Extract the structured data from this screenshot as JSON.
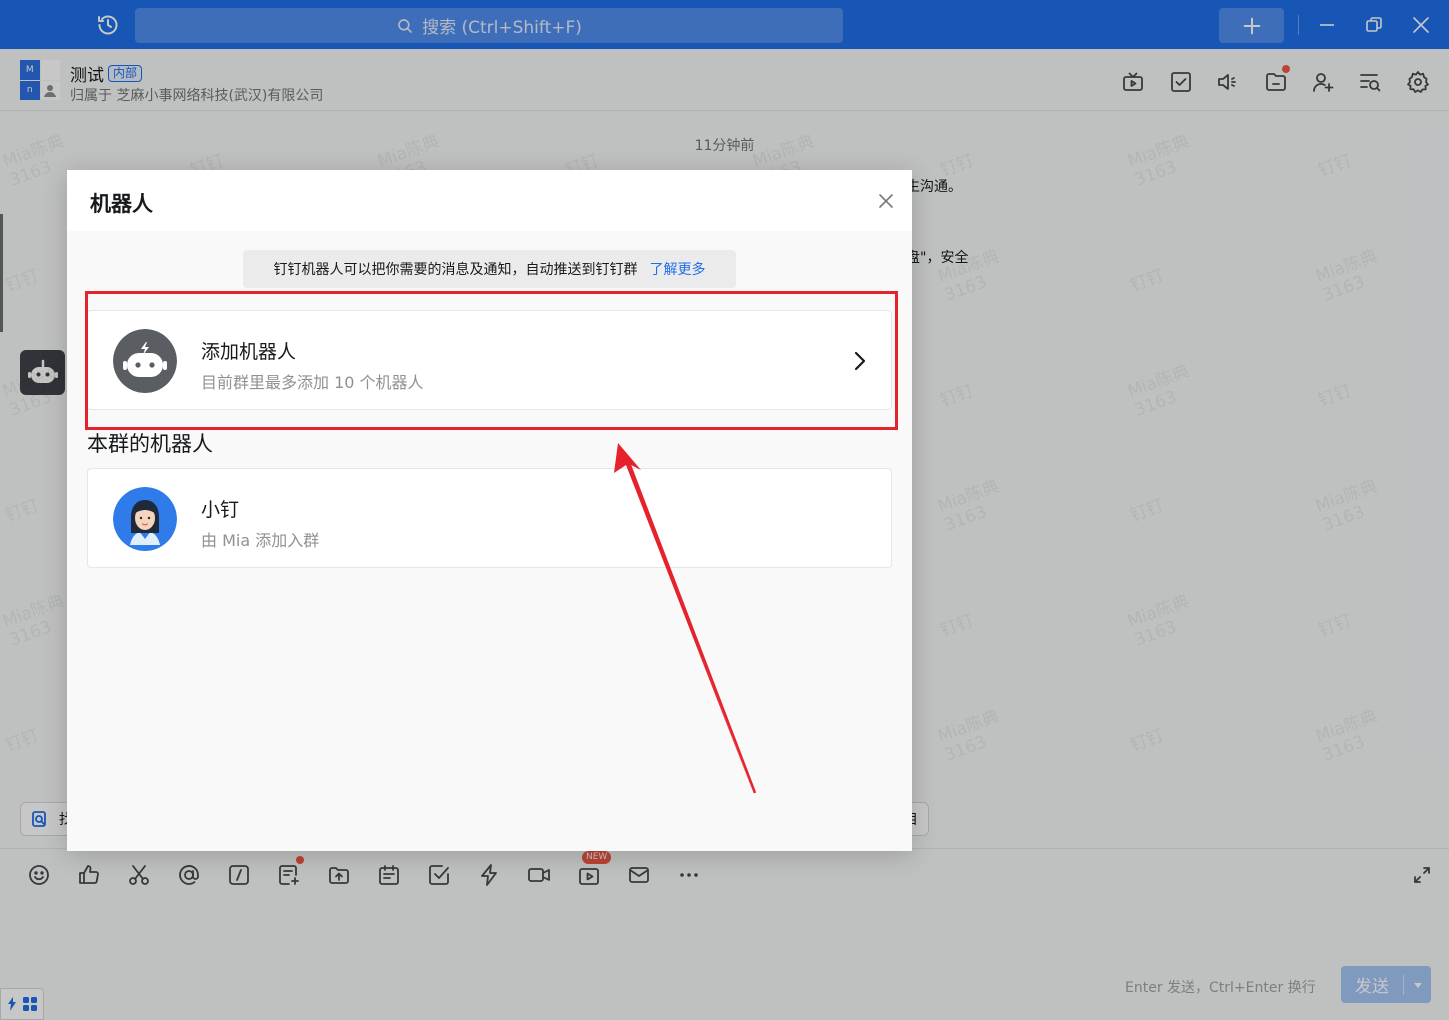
{
  "titlebar": {
    "search_placeholder": "搜索 (Ctrl+Shift+F)"
  },
  "chat": {
    "group_name": "测试",
    "group_tag": "内部",
    "group_owner": "归属于 芝麻小事网络科技(武汉)有限公司",
    "avatar_letters": [
      "M",
      "n"
    ],
    "timestamp": "11分钟前",
    "msg_fragment_1": "生沟通。",
    "msg_fragment_2": "盘\"，安全",
    "watermark_name": "Mia陈典",
    "watermark_id": "3163",
    "watermark_brand": "钉钉",
    "quickbar_start": "找",
    "quickbar_end": "目"
  },
  "input": {
    "new_badge": "NEW",
    "send_hint": "Enter 发送，Ctrl+Enter 换行",
    "send_label": "发送"
  },
  "modal": {
    "title": "机器人",
    "notice": "钉钉机器人可以把你需要的消息及通知，自动推送到钉钉群",
    "learn_more": "了解更多",
    "add_robot": {
      "title": "添加机器人",
      "subtitle": "目前群里最多添加 10 个机器人"
    },
    "section_title": "本群的机器人",
    "robots": [
      {
        "name": "小钉",
        "added_by": "由 Mia 添加入群"
      }
    ]
  },
  "colors": {
    "brand_blue": "#1f6fe8",
    "annotation_red": "#e6222c",
    "notification_red": "#f25643"
  }
}
